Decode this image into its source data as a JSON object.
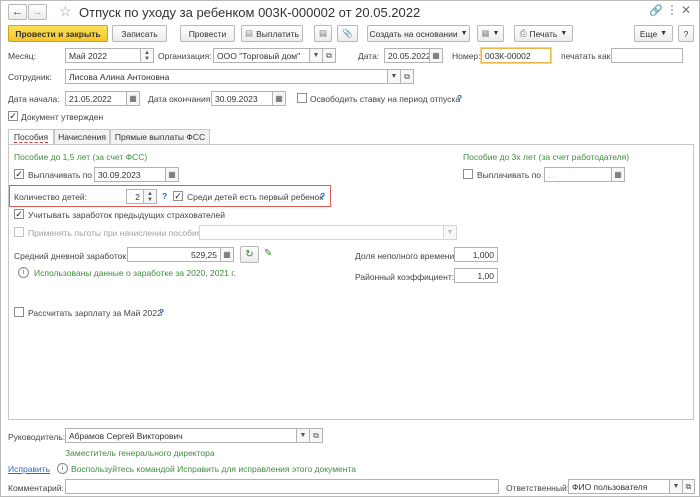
{
  "titlebar": {
    "title": "Отпуск по уходу за ребенком 003К-000002 от 20.05.2022",
    "link_icon": "link-icon",
    "more_icon": "ellipsis-icon",
    "close_icon": "close-icon"
  },
  "toolbar": {
    "post_close": "Провести и закрыть",
    "save": "Записать",
    "post": "Провести",
    "pay": "Выплатить",
    "create_based": "Создать на основании",
    "print": "Печать",
    "more": "Еще",
    "help": "?"
  },
  "header": {
    "month_label": "Месяц:",
    "month_value": "Май 2022",
    "org_label": "Организация:",
    "org_value": "ООО \"Торговый дом\"",
    "date_label": "Дата:",
    "date_value": "20.05.2022",
    "number_label": "Номер:",
    "number_value": "003К-00002",
    "print_as_label": "печатать как:",
    "print_as_value": "",
    "employee_label": "Сотрудник:",
    "employee_value": "Лисова Алина Антоновна",
    "start_label": "Дата начала:",
    "start_value": "21.05.2022",
    "end_label": "Дата окончания:",
    "end_value": "30.09.2023",
    "free_rate_label": "Освободить ставку на период отпуска",
    "doc_approved_label": "Документ утвержден"
  },
  "tabs": [
    "Пособия",
    "Начисления",
    "Прямые выплаты ФСС"
  ],
  "benefits": {
    "left_header": "Пособие до 1,5 лет (за счет ФСС)",
    "pay_until_label": "Выплачивать по",
    "pay_until_value": "30.09.2023",
    "children_count_label": "Количество детей:",
    "children_count_value": "2",
    "first_child_label": "Среди детей есть первый ребенок",
    "prev_earnings_label": "Учитывать заработок предыдущих страхователей",
    "privileges_label": "Применять льготы при начислении пособия:",
    "avg_earnings_label": "Средний дневной заработок:",
    "avg_earnings_value": "529,25",
    "earnings_info": "Использованы данные о заработке за  2020,  2021 г.",
    "right_header": "Пособие до 3х лет (за счет работодателя)",
    "right_pay_until_label": "Выплачивать по",
    "right_pay_until_value": ".  .",
    "part_time_label": "Доля неполного времени:",
    "part_time_value": "1,000",
    "regional_label": "Районный коэффициент:",
    "regional_value": "1,00",
    "calc_salary_label": "Рассчитать зарплату за Май 2022"
  },
  "footer": {
    "head_label": "Руководитель:",
    "head_value": "Абрамов Сергей Викторович",
    "head_position": "Заместитель генерального директора",
    "fix_link": "Исправить",
    "fix_hint": "Воспользуйтесь командой Исправить для исправления этого документа",
    "comment_label": "Комментарий:",
    "comment_value": "",
    "responsible_label": "Ответственный:",
    "responsible_value": "ФИО пользователя"
  }
}
